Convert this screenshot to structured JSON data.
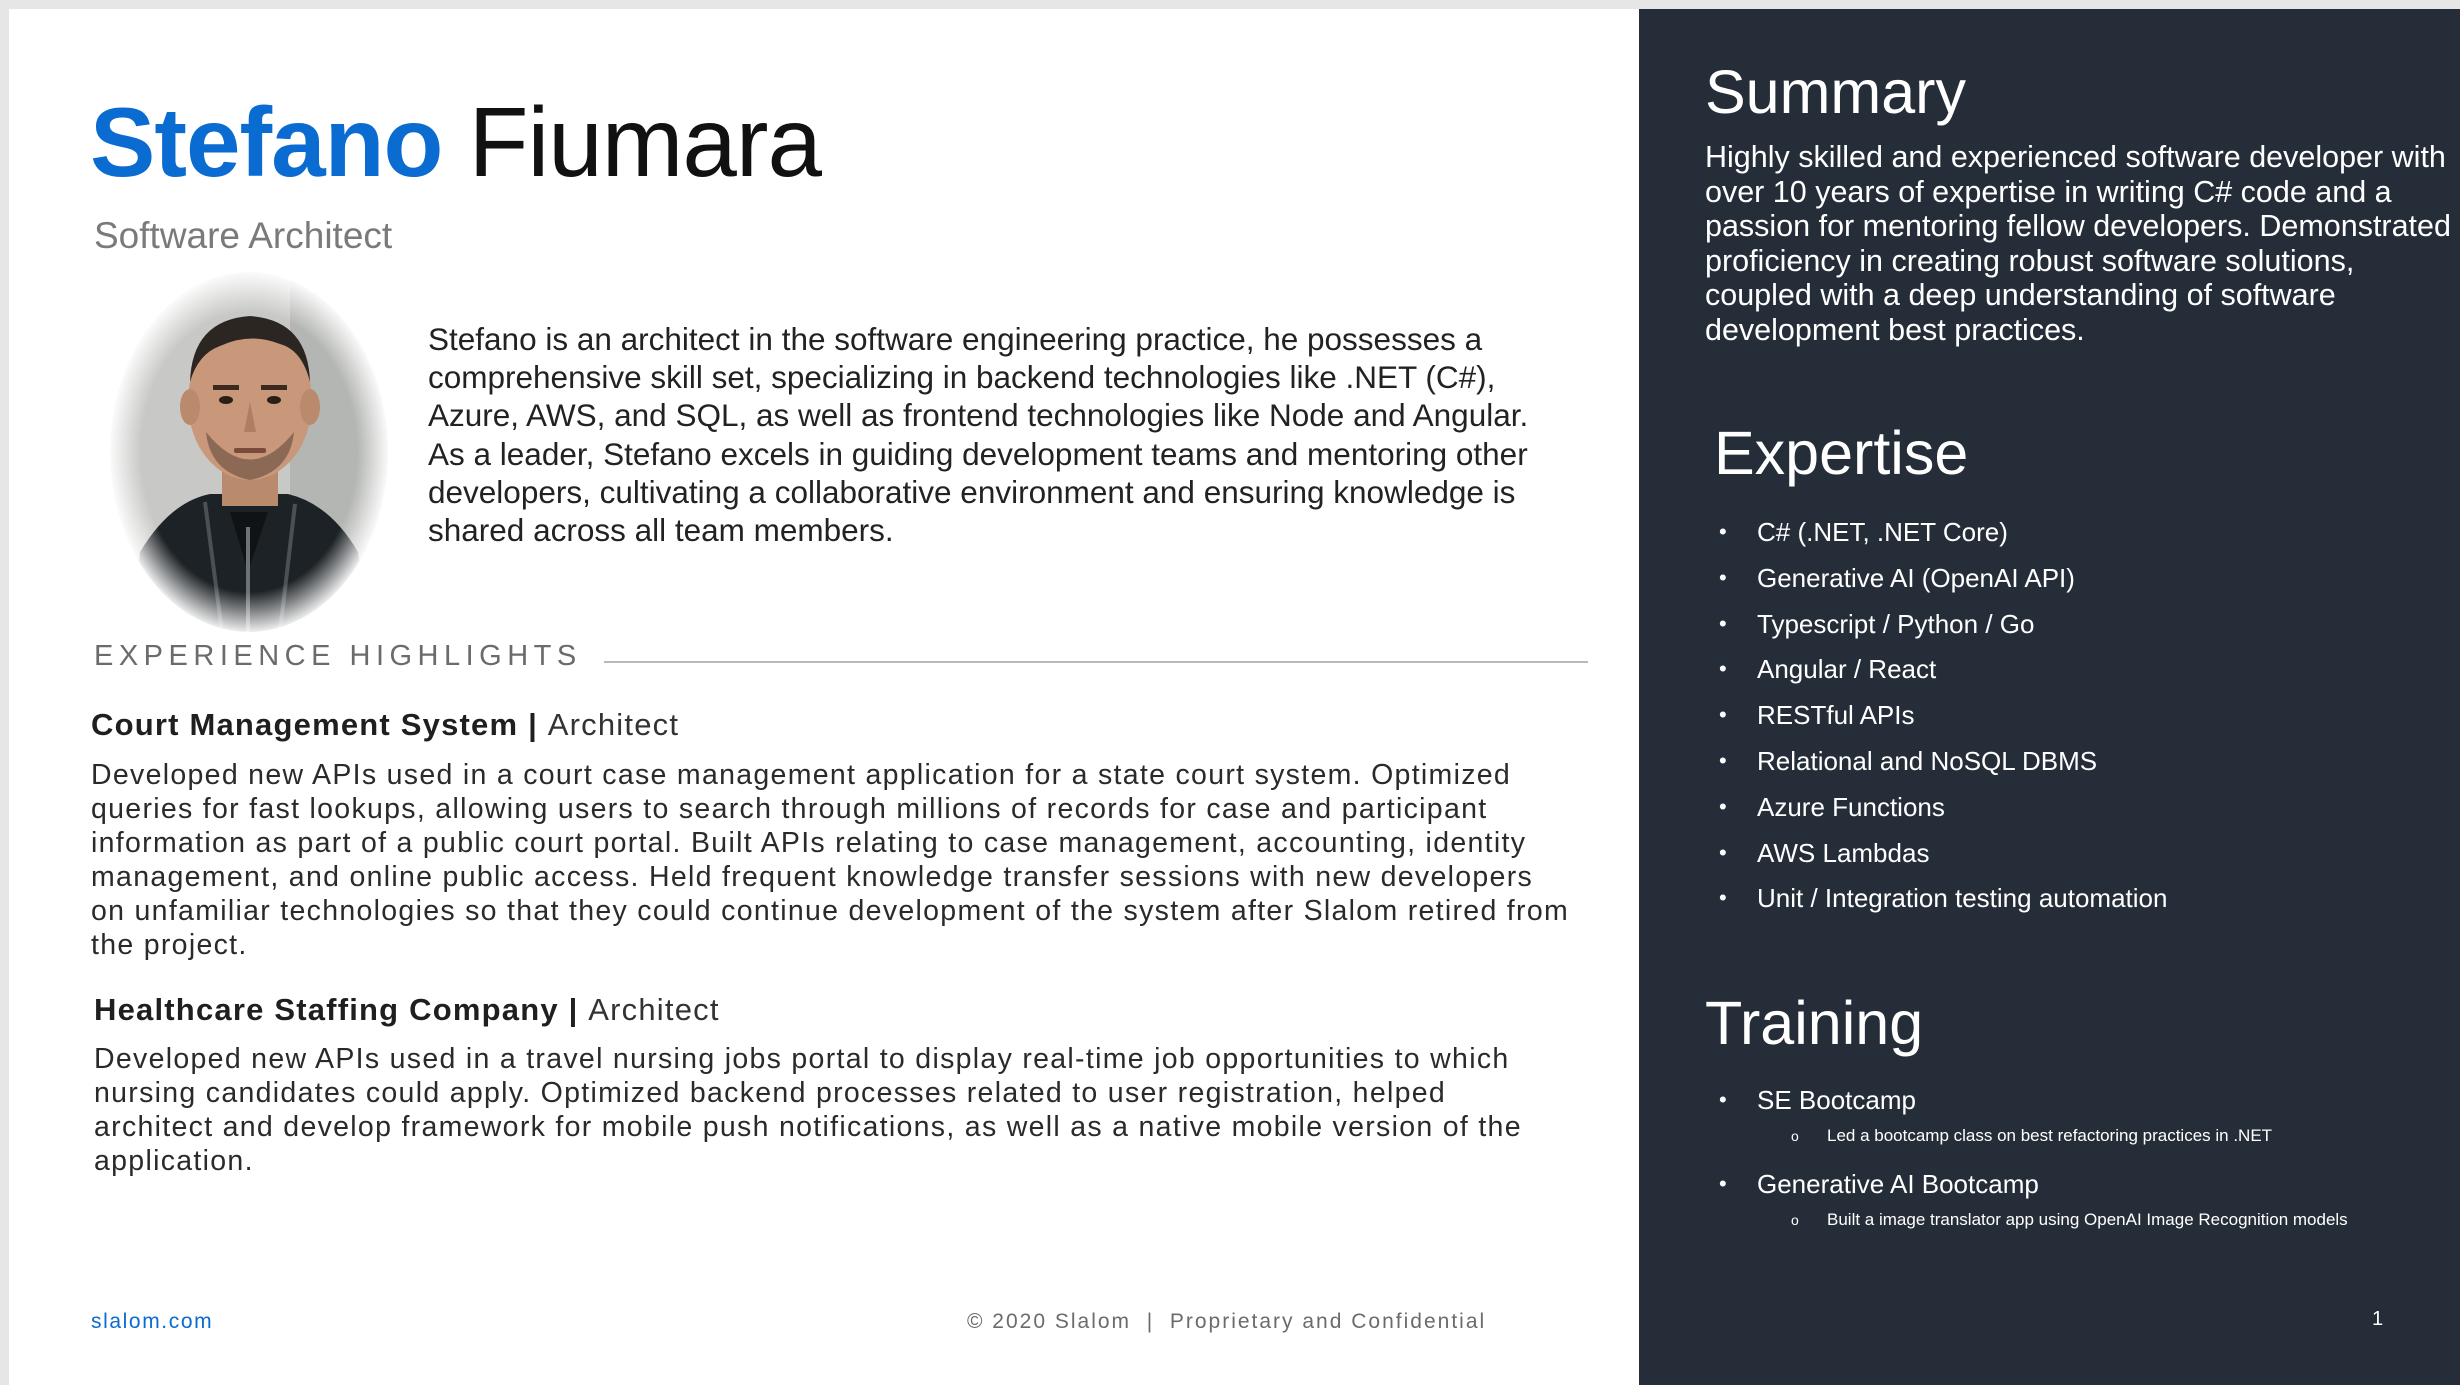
{
  "profile": {
    "first_name": "Stefano",
    "last_name": "Fiumara",
    "role": "Software Architect",
    "bio": "Stefano is an architect in the software engineering practice, he possesses a comprehensive skill set, specializing in backend technologies like .NET (C#), Azure, AWS, and SQL, as well as frontend technologies like Node and Angular. As a leader, Stefano excels in guiding development teams and mentoring other developers, cultivating a collaborative environment and ensuring knowledge is shared across all team members."
  },
  "experience": {
    "heading": "EXPERIENCE HIGHLIGHTS",
    "jobs": [
      {
        "company": "Court Management System",
        "separator": " | ",
        "position": "Architect",
        "description": "Developed new APIs used in a court case management application for a state court system. Optimized queries for fast lookups, allowing users to search through millions of records for case and participant information as part of a public court portal. Built APIs relating to case management, accounting, identity management, and online public access. Held frequent knowledge transfer sessions with new developers on unfamiliar technologies so that they could continue development of the system after Slalom retired from the project."
      },
      {
        "company": "Healthcare Staffing Company",
        "separator": " | ",
        "position": "Architect",
        "description": "Developed new APIs used in a travel nursing jobs portal to display real-time job opportunities to which nursing candidates could apply. Optimized backend processes related to user registration, helped architect and develop framework for mobile push notifications, as well as a native mobile version of the application."
      }
    ]
  },
  "summary": {
    "heading": "Summary",
    "text": "Highly skilled and experienced software developer with over 10 years of expertise in writing C# code and a passion for mentoring fellow developers. Demonstrated proficiency in creating robust software solutions, coupled with a deep understanding of software development best practices."
  },
  "expertise": {
    "heading": "Expertise",
    "items": [
      "C# (.NET, .NET Core)",
      "Generative AI (OpenAI API)",
      "Typescript / Python / Go",
      "Angular / React",
      "RESTful APIs",
      "Relational and NoSQL DBMS",
      "Azure Functions",
      "AWS Lambdas",
      "Unit / Integration testing automation"
    ]
  },
  "training": {
    "heading": "Training",
    "items": [
      {
        "title": "SE Bootcamp",
        "detail": "Led a bootcamp class on best refactoring practices in .NET"
      },
      {
        "title": "Generative AI Bootcamp",
        "detail": "Built a image translator app using OpenAI Image Recognition models"
      }
    ]
  },
  "footer": {
    "link": "slalom.com",
    "copyright": "© 2020 Slalom  |  Proprietary and Confidential",
    "page_number": "1"
  },
  "colors": {
    "accent_blue": "#0a6bd0",
    "side_panel": "#252e38"
  },
  "icons": {
    "bullet": "bullet-dot",
    "sub_bullet": "ring-bullet",
    "avatar": "profile-photo"
  }
}
